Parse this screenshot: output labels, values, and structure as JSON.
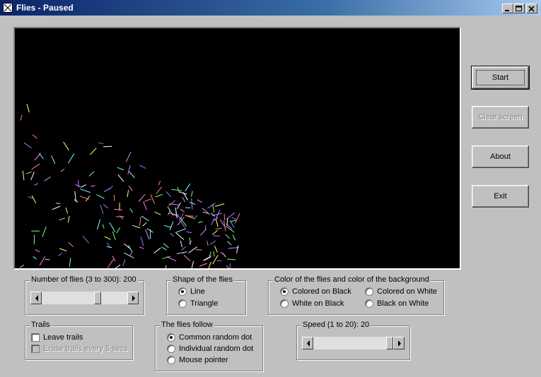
{
  "window": {
    "title": "Flies - Paused",
    "icon": "flies-app-icon",
    "controls": [
      "minimize-icon",
      "maximize-icon",
      "close-icon"
    ]
  },
  "buttons": {
    "start": "Start",
    "clear": "Clear screen",
    "about": "About",
    "exit": "Exit"
  },
  "number_of_flies": {
    "label": "Number of flies (3 to 300): 200",
    "value": 200,
    "min": 3,
    "max": 300
  },
  "shape": {
    "label": "Shape of the flies",
    "options": [
      "Line",
      "Triangle"
    ],
    "selected": "Line"
  },
  "color": {
    "label": "Color of the flies and color of the background",
    "options": [
      "Colored on Black",
      "Colored on White",
      "White on Black",
      "Black on White"
    ],
    "selected": "Colored on Black"
  },
  "trails": {
    "label": "Trails",
    "leave": "Leave trails",
    "erase": "Erase trails every 5 secs.",
    "leave_checked": false,
    "erase_enabled": false
  },
  "follow": {
    "label": "The flies follow",
    "options": [
      "Common random dot",
      "Individual random dot",
      "Mouse pointer"
    ],
    "selected": "Common random dot"
  },
  "speed": {
    "label": "Speed (1 to 20): 20",
    "value": 20,
    "min": 1,
    "max": 20
  },
  "colors": {
    "canvas": "#000000",
    "fly_palette": [
      "#ff80ff",
      "#80ff80",
      "#8080ff",
      "#ffff80",
      "#80ffff",
      "#ff8080",
      "#ffffff",
      "#c080ff"
    ]
  }
}
